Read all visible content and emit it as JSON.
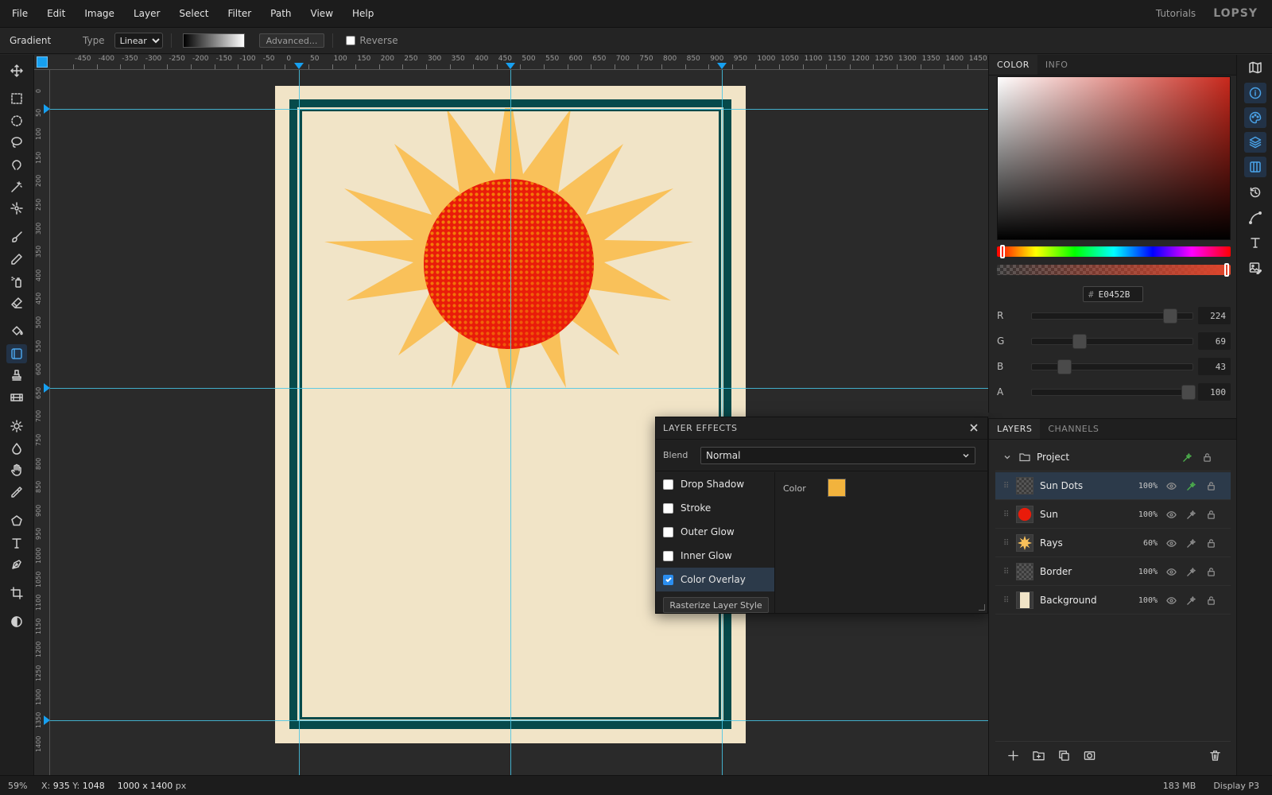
{
  "menu": [
    "File",
    "Edit",
    "Image",
    "Layer",
    "Select",
    "Filter",
    "Path",
    "View",
    "Help"
  ],
  "header": {
    "tutorials": "Tutorials",
    "logo": "LOPSY"
  },
  "options": {
    "tool_name": "Gradient",
    "type_label": "Type",
    "type_value": "Linear",
    "advanced_label": "Advanced...",
    "reverse_label": "Reverse"
  },
  "ruler_top": [
    "-450",
    "-400",
    "-350",
    "-300",
    "-250",
    "-200",
    "-150",
    "-100",
    "-50",
    "0",
    "50",
    "100",
    "150",
    "200",
    "250",
    "300",
    "350",
    "400",
    "450",
    "500",
    "550",
    "600",
    "650",
    "700",
    "750",
    "800",
    "850",
    "900",
    "950",
    "1000",
    "1050",
    "1100",
    "1150",
    "1200",
    "1250",
    "1300",
    "1350",
    "1400",
    "1450"
  ],
  "ruler_left": [
    "0",
    "50",
    "100",
    "150",
    "200",
    "250",
    "300",
    "350",
    "400",
    "450",
    "500",
    "550",
    "600",
    "650",
    "700",
    "750",
    "800",
    "850",
    "900",
    "950",
    "1000",
    "1050",
    "1100",
    "1150",
    "1200",
    "1250",
    "1300",
    "1350",
    "1400"
  ],
  "color_panel": {
    "tabs": [
      "COLOR",
      "INFO"
    ],
    "hex_value": "E0452B",
    "hex_prefix": "#",
    "channels": [
      {
        "label": "R",
        "value": "224",
        "fraction": 0.878
      },
      {
        "label": "G",
        "value": "69",
        "fraction": 0.271
      },
      {
        "label": "B",
        "value": "43",
        "fraction": 0.169
      },
      {
        "label": "A",
        "value": "100",
        "fraction": 1.0
      }
    ],
    "hue_fraction": 0.024,
    "accent": "#E0452B"
  },
  "layer_effects": {
    "title": "LAYER EFFECTS",
    "blend_label": "Blend",
    "blend_value": "Normal",
    "effects": [
      {
        "label": "Drop Shadow",
        "checked": false
      },
      {
        "label": "Stroke",
        "checked": false
      },
      {
        "label": "Outer Glow",
        "checked": false
      },
      {
        "label": "Inner Glow",
        "checked": false
      },
      {
        "label": "Color Overlay",
        "checked": true
      }
    ],
    "rasterize_label": "Rasterize Layer Style",
    "color_label": "Color",
    "overlay_color": "#F2B33D"
  },
  "layers_panel": {
    "tabs": [
      "LAYERS",
      "CHANNELS"
    ],
    "group": "Project",
    "layers": [
      {
        "name": "Sun Dots",
        "opacity": "100%",
        "thumb": "checker",
        "fx": true
      },
      {
        "name": "Sun",
        "opacity": "100%",
        "thumb": "sun",
        "fx": false
      },
      {
        "name": "Rays",
        "opacity": "60%",
        "thumb": "rays",
        "fx": false
      },
      {
        "name": "Border",
        "opacity": "100%",
        "thumb": "checker",
        "fx": false
      },
      {
        "name": "Background",
        "opacity": "100%",
        "thumb": "background",
        "fx": false
      }
    ]
  },
  "status": {
    "zoom": "59%",
    "x_label": "X:",
    "x_value": "935",
    "y_label": "Y:",
    "y_value": "1048",
    "doc_size": "1000 x 1400",
    "doc_unit": "px",
    "memory": "183 MB",
    "color_profile": "Display P3"
  },
  "colors": {
    "paper": "#F1E4C7",
    "frame": "#064A4B",
    "rays": "#F9C15A",
    "sun": "#E91B0A",
    "guide": "#47C6E6",
    "accent": "#17A0F0"
  }
}
